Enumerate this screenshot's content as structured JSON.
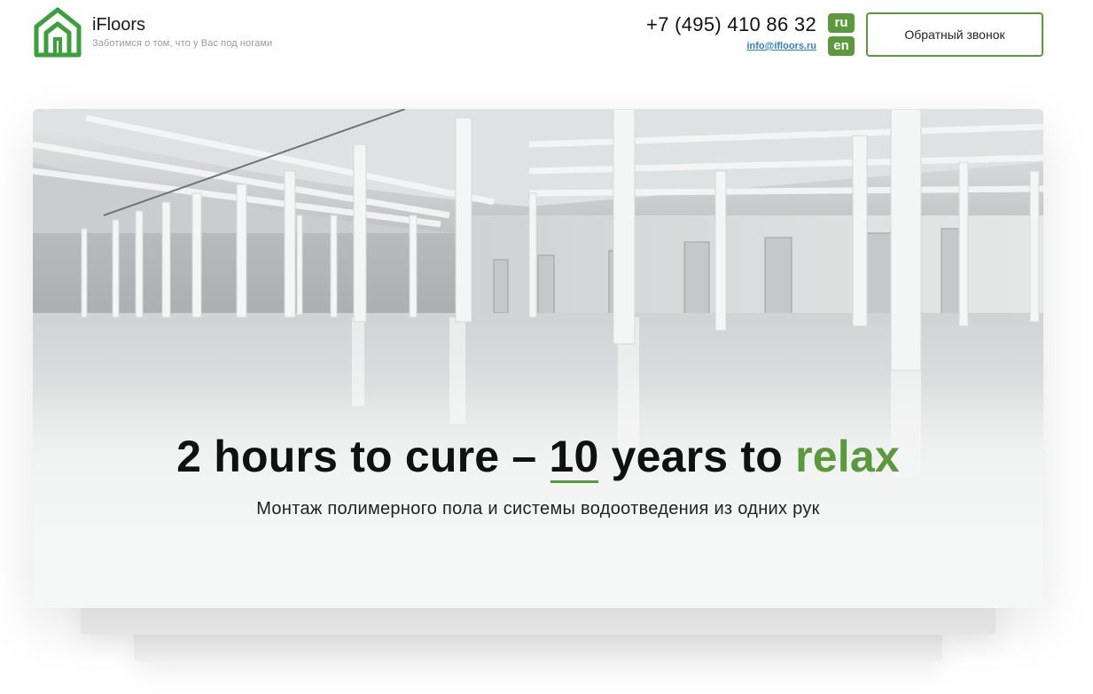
{
  "header": {
    "brand": "iFloors",
    "tagline": "Заботимся о том, что у Вас под ногами",
    "phone": "+7 (495) 410 86 32",
    "email": "info@ifloors.ru",
    "languages": [
      "ru",
      "en"
    ],
    "callback_label": "Обратный звонок"
  },
  "hero": {
    "headline_part1": "2 hours to cure – ",
    "headline_number": "10",
    "headline_part2": " years to ",
    "headline_accent": "relax",
    "subheadline": "Монтаж полимерного пола и системы водоотведения из одних рук",
    "image": "warehouse-floor-image"
  },
  "colors": {
    "accent": "#5a9a3c",
    "link": "#2b7fd4",
    "text": "#111111"
  }
}
